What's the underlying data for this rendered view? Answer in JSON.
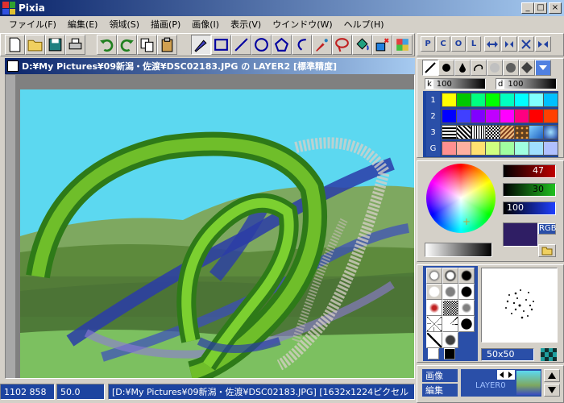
{
  "app": {
    "title": "Pixia"
  },
  "window_buttons": {
    "minimize": "_",
    "maximize": "□",
    "close": "×"
  },
  "menu": [
    "ファイル(F)",
    "編集(E)",
    "領域(S)",
    "描画(P)",
    "画像(I)",
    "表示(V)",
    "ウインドウ(W)",
    "ヘルプ(H)"
  ],
  "right_toolbar": {
    "p": "P",
    "c": "C",
    "o": "O",
    "l": "L"
  },
  "document": {
    "title": "D:¥My Pictures¥09新潟・佐渡¥DSC02183.JPG の LAYER2 [標準精度]"
  },
  "brush_settings": {
    "size_label": "k",
    "size_value": "100",
    "density_label": "d",
    "density_value": "100"
  },
  "palette": {
    "rows": [
      "1",
      "2",
      "3",
      "G"
    ],
    "row1": [
      "#ffff00",
      "#00c800",
      "#00ff80",
      "#00ff00",
      "#00ffc0",
      "#00ffff",
      "#80ffff",
      "#00c0ff"
    ],
    "row2": [
      "#0000ff",
      "#4040ff",
      "#8000ff",
      "#c000ff",
      "#ff00ff",
      "#ff0080",
      "#ff0000",
      "#ff4000"
    ],
    "row4": [
      "#ff9090",
      "#ffb0a0",
      "#ffe070",
      "#d0ff80",
      "#a0ffa0",
      "#a0ffe0",
      "#a0e0ff",
      "#b0c0ff"
    ]
  },
  "color": {
    "r": "47",
    "g": "30",
    "b": "100",
    "mode": "RGB"
  },
  "brush_size": {
    "value": "50x50"
  },
  "status": {
    "coords": "1102 858",
    "zoom": "50.0",
    "info": "[D:¥My Pictures¥09新潟・佐渡¥DSC02183.JPG] [1632x1224ピクセル"
  },
  "bottom_panel": {
    "image_tab": "画像",
    "edit_tab": "編集",
    "layer_name": "LAYER0"
  }
}
